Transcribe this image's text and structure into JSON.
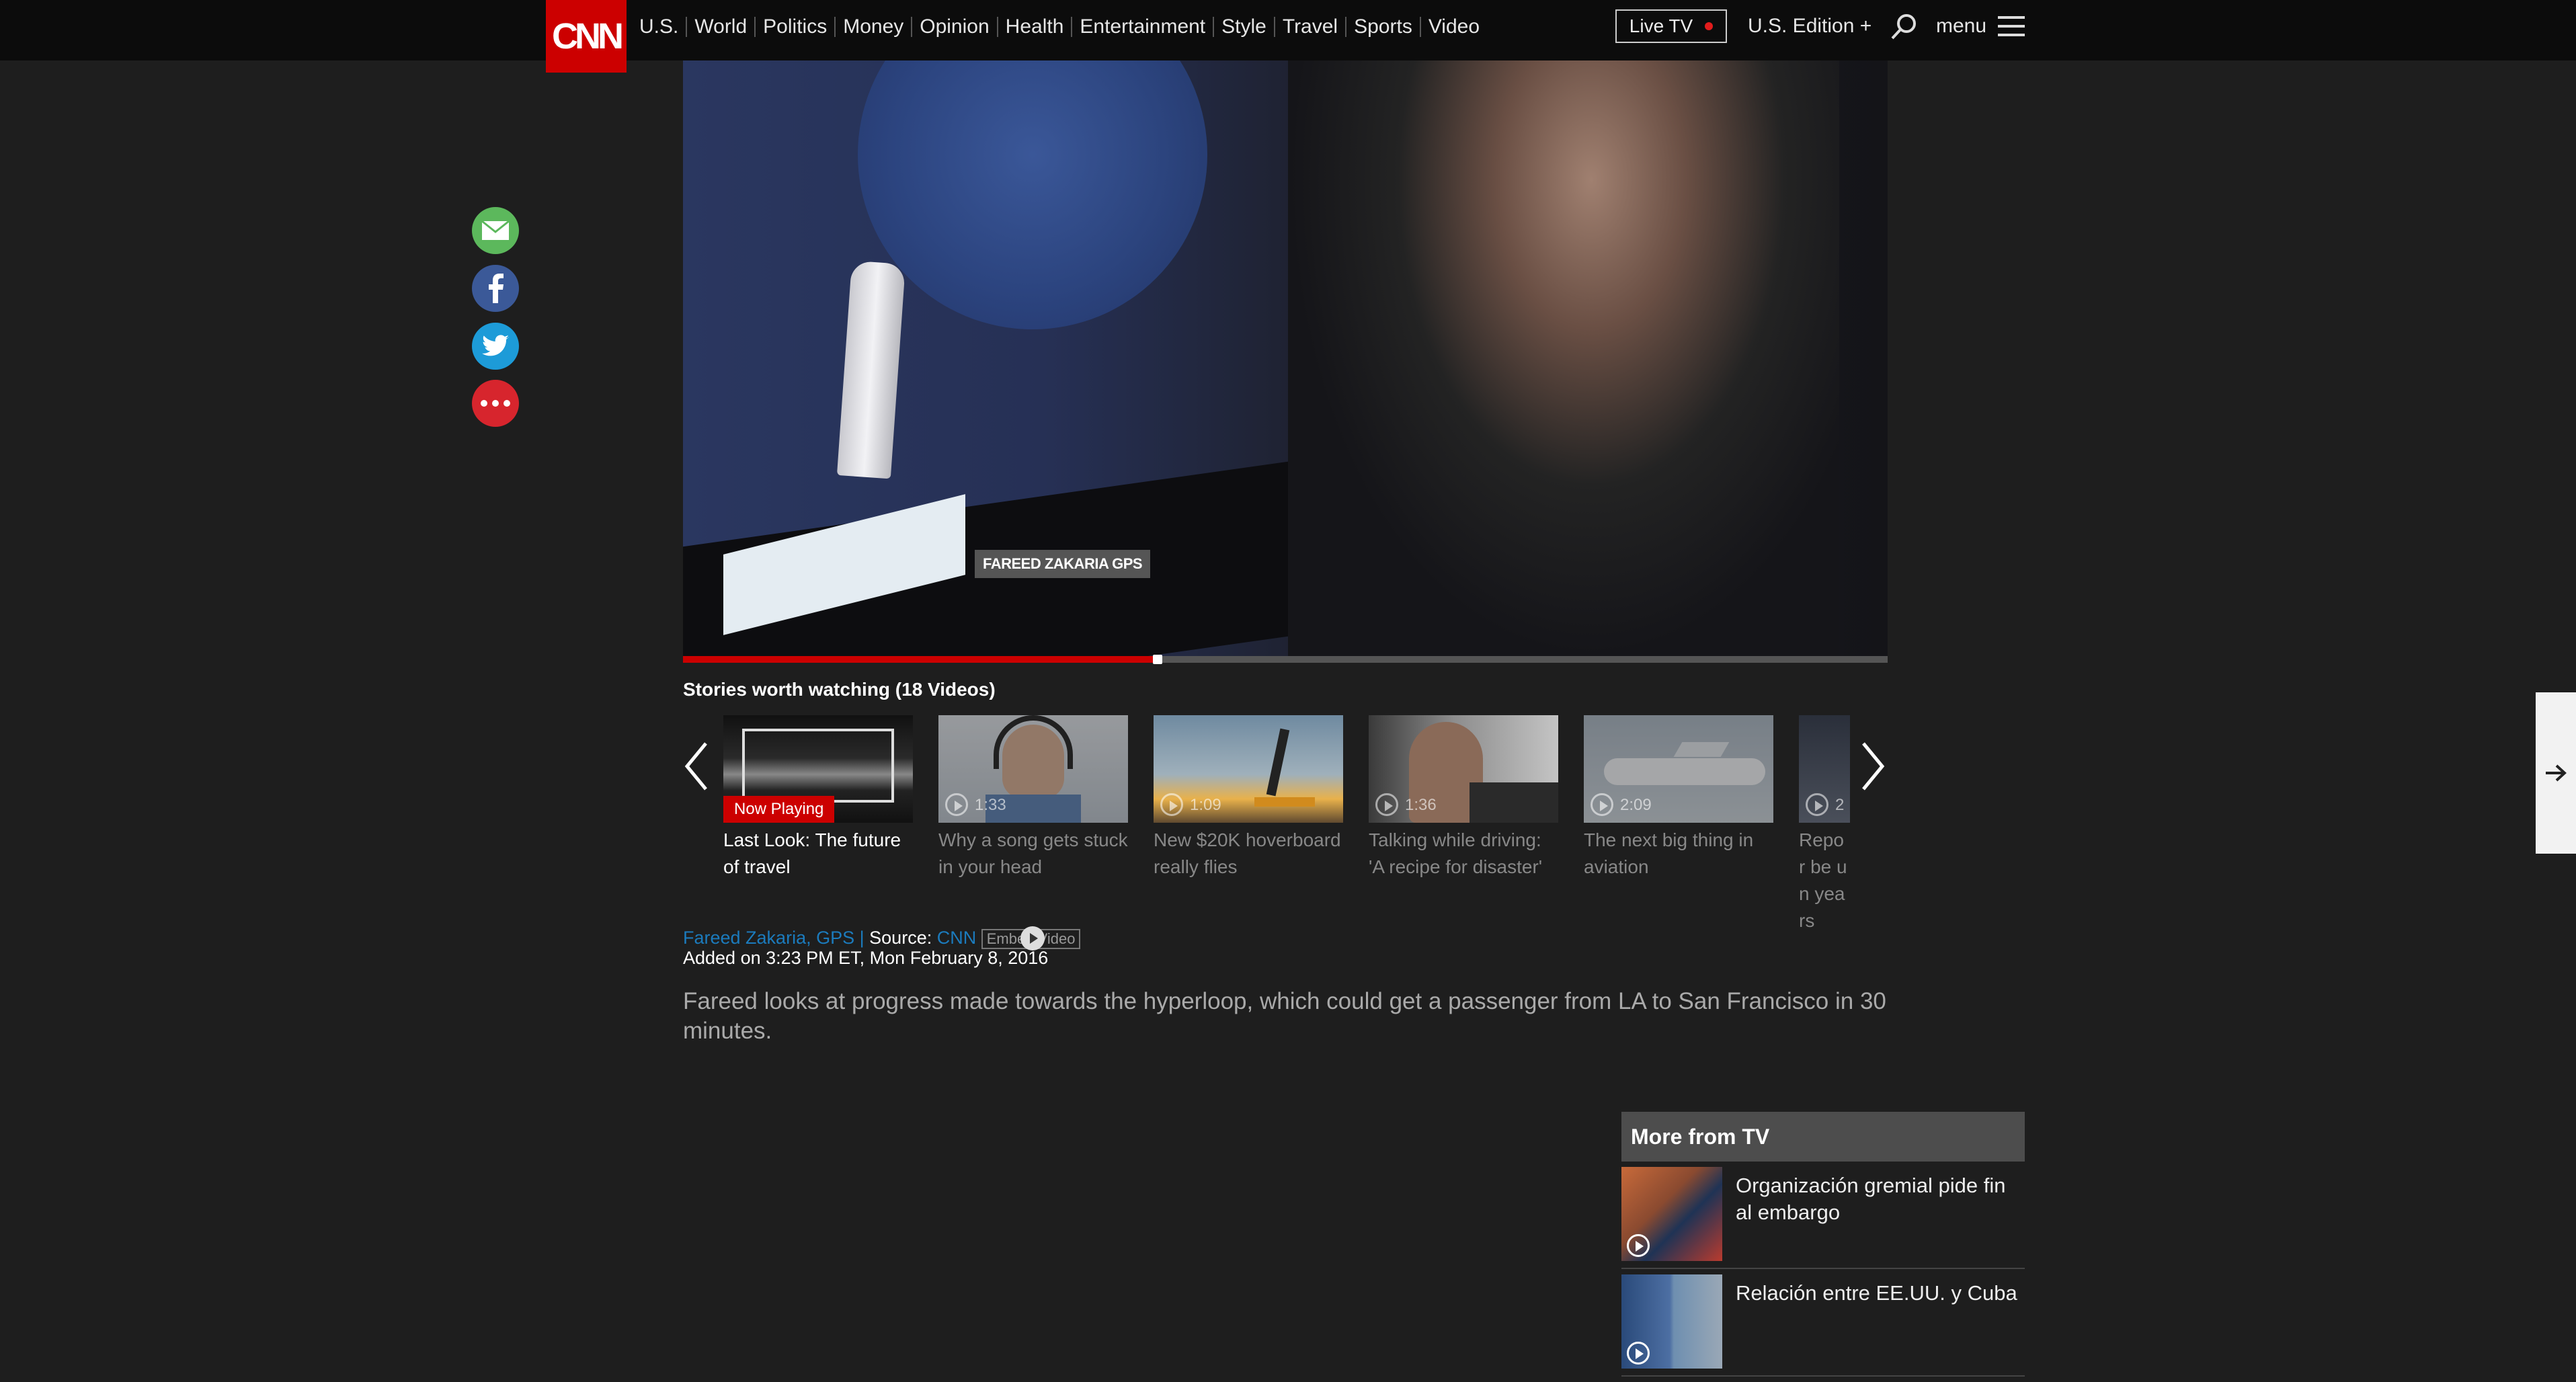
{
  "header": {
    "logo_text": "CNN",
    "nav": [
      "U.S.",
      "World",
      "Politics",
      "Money",
      "Opinion",
      "Health",
      "Entertainment",
      "Style",
      "Travel",
      "Sports",
      "Video"
    ],
    "live_tv": "Live TV",
    "edition": "U.S. Edition +",
    "menu": "menu"
  },
  "share": [
    "email-icon",
    "facebook-icon",
    "twitter-icon",
    "more-icon"
  ],
  "video": {
    "watermark": "FAREED ZAKARIA GPS",
    "progress": 0.39
  },
  "carousel": {
    "title": "Stories worth watching (18 Videos)",
    "items": [
      {
        "caption": "Last Look: The future of travel",
        "duration": "",
        "badge": "Now Playing"
      },
      {
        "caption": "Why a song gets stuck in your head",
        "duration": "1:33",
        "badge": ""
      },
      {
        "caption": "New $20K hoverboard really flies",
        "duration": "1:09",
        "badge": ""
      },
      {
        "caption": "Talking while driving: 'A recipe for disaster'",
        "duration": "1:36",
        "badge": ""
      },
      {
        "caption": "The next big thing in aviation",
        "duration": "2:09",
        "badge": ""
      },
      {
        "caption": "Repor be un years",
        "duration": "2",
        "badge": ""
      }
    ]
  },
  "meta": {
    "author": "Fareed Zakaria, GPS",
    "source_label": "Source:",
    "source": "CNN",
    "embed": "Embed Video",
    "added": "Added on 3:23 PM ET, Mon February 8, 2016",
    "description": "Fareed looks at progress made towards the hyperloop, which could get a passenger from LA to San Francisco in 30 minutes."
  },
  "more_tv": {
    "title": "More from TV",
    "items": [
      {
        "title": "Organización gremial pide fin al embargo"
      },
      {
        "title": "Relación entre EE.UU. y Cuba"
      }
    ]
  }
}
